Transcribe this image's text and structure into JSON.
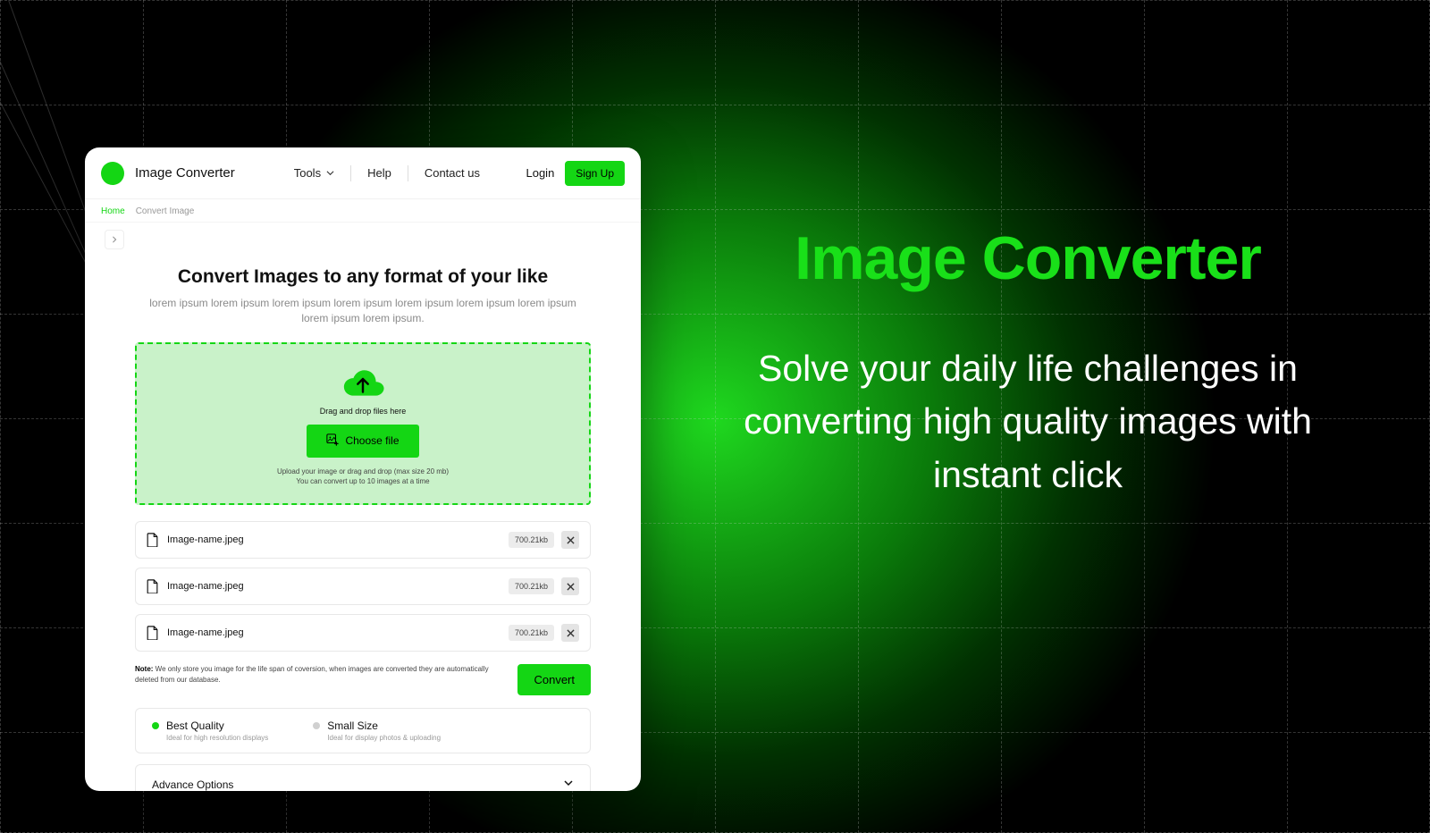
{
  "promo": {
    "title": "Image Converter",
    "tagline": "Solve your daily life challenges in converting high quality images with instant click"
  },
  "header": {
    "brand": "Image Converter",
    "nav": {
      "tools": "Tools",
      "help": "Help",
      "contact": "Contact us"
    },
    "login": "Login",
    "signup": "Sign Up"
  },
  "crumbs": {
    "home": "Home",
    "current": "Convert Image"
  },
  "main": {
    "title": "Convert Images to any format of your like",
    "subtitle": "lorem ipsum lorem ipsum lorem ipsum lorem ipsum lorem ipsum lorem ipsum lorem ipsum lorem ipsum lorem ipsum."
  },
  "drop": {
    "drag_label": "Drag and drop files here",
    "choose_label": "Choose file",
    "hint_line1": "Upload your image or drag and drop (max size 20 mb)",
    "hint_line2": "You can convert up to 10 images at a time"
  },
  "files": [
    {
      "name": "Image-name.jpeg",
      "size": "700.21kb"
    },
    {
      "name": "Image-name.jpeg",
      "size": "700.21kb"
    },
    {
      "name": "Image-name.jpeg",
      "size": "700.21kb"
    }
  ],
  "note": {
    "label": "Note:",
    "text": " We only store you image for the life span of coversion, when images are converted they are automatically deleted from our database."
  },
  "convert_label": "Convert",
  "quality": {
    "best": {
      "label": "Best Quality",
      "sub": "Ideal for high resolution displays"
    },
    "small": {
      "label": "Small Size",
      "sub": "Ideal for display photos & uploading"
    }
  },
  "advance_label": "Advance Options"
}
